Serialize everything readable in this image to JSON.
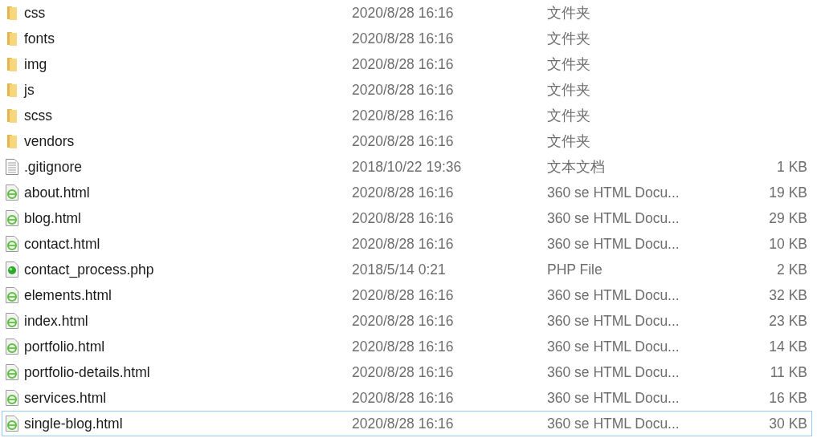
{
  "files": [
    {
      "kind": "folder",
      "name": "css",
      "modified": "2020/8/28 16:16",
      "type": "文件夹",
      "focused": false
    },
    {
      "kind": "folder",
      "name": "fonts",
      "modified": "2020/8/28 16:16",
      "type": "文件夹",
      "focused": false
    },
    {
      "kind": "folder",
      "name": "img",
      "modified": "2020/8/28 16:16",
      "type": "文件夹",
      "focused": false
    },
    {
      "kind": "folder",
      "name": "js",
      "modified": "2020/8/28 16:16",
      "type": "文件夹",
      "focused": false
    },
    {
      "kind": "folder",
      "name": "scss",
      "modified": "2020/8/28 16:16",
      "type": "文件夹",
      "focused": false
    },
    {
      "kind": "folder",
      "name": "vendors",
      "modified": "2020/8/28 16:16",
      "type": "文件夹",
      "focused": false
    },
    {
      "kind": "text",
      "name": ".gitignore",
      "modified": "2018/10/22 19:36",
      "type": "文本文档",
      "size": "1 KB",
      "focused": false
    },
    {
      "kind": "html",
      "name": "about.html",
      "modified": "2020/8/28 16:16",
      "type": "360 se HTML Docu...",
      "size": "19 KB",
      "focused": false
    },
    {
      "kind": "html",
      "name": "blog.html",
      "modified": "2020/8/28 16:16",
      "type": "360 se HTML Docu...",
      "size": "29 KB",
      "focused": false
    },
    {
      "kind": "html",
      "name": "contact.html",
      "modified": "2020/8/28 16:16",
      "type": "360 se HTML Docu...",
      "size": "10 KB",
      "focused": false
    },
    {
      "kind": "php",
      "name": "contact_process.php",
      "modified": "2018/5/14 0:21",
      "type": "PHP File",
      "size": "2 KB",
      "focused": false
    },
    {
      "kind": "html",
      "name": "elements.html",
      "modified": "2020/8/28 16:16",
      "type": "360 se HTML Docu...",
      "size": "32 KB",
      "focused": false
    },
    {
      "kind": "html",
      "name": "index.html",
      "modified": "2020/8/28 16:16",
      "type": "360 se HTML Docu...",
      "size": "23 KB",
      "focused": false
    },
    {
      "kind": "html",
      "name": "portfolio.html",
      "modified": "2020/8/28 16:16",
      "type": "360 se HTML Docu...",
      "size": "14 KB",
      "focused": false
    },
    {
      "kind": "html",
      "name": "portfolio-details.html",
      "modified": "2020/8/28 16:16",
      "type": "360 se HTML Docu...",
      "size": "11 KB",
      "focused": false
    },
    {
      "kind": "html",
      "name": "services.html",
      "modified": "2020/8/28 16:16",
      "type": "360 se HTML Docu...",
      "size": "16 KB",
      "focused": false
    },
    {
      "kind": "html",
      "name": "single-blog.html",
      "modified": "2020/8/28 16:16",
      "type": "360 se HTML Docu...",
      "size": "30 KB",
      "focused": true
    }
  ]
}
